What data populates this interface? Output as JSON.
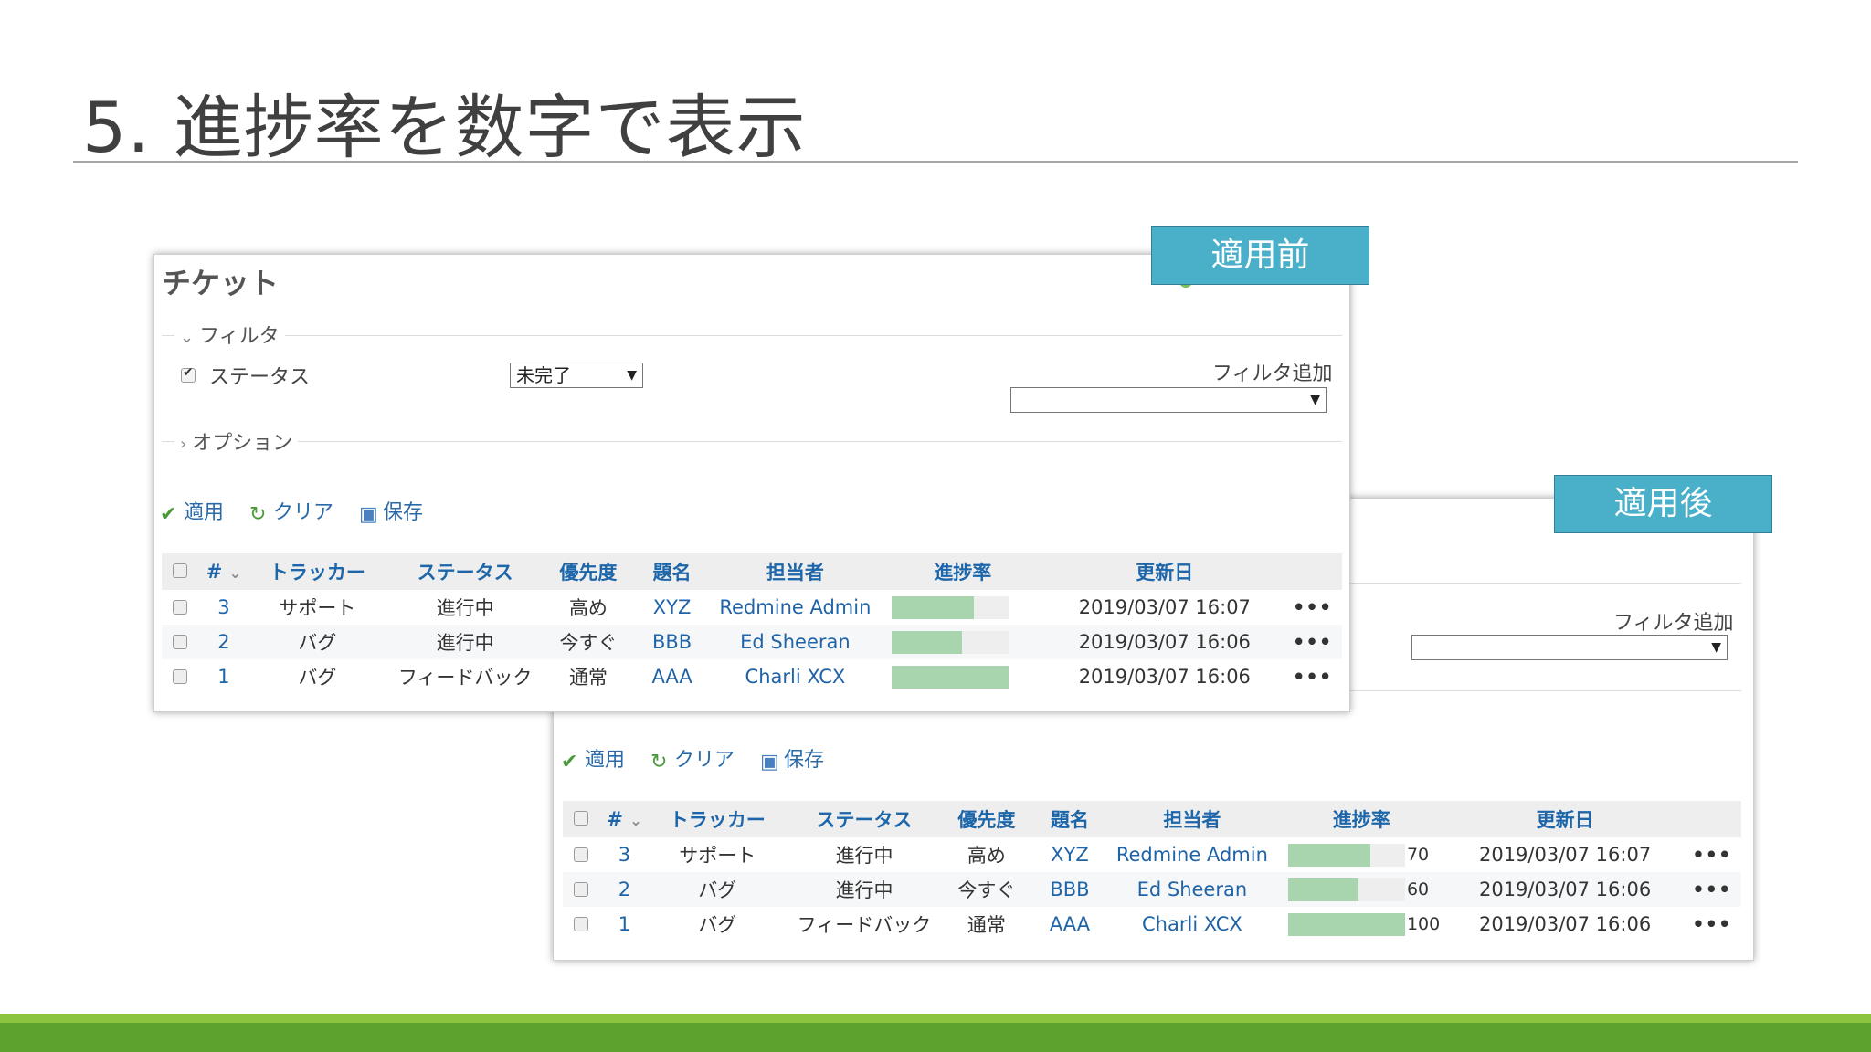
{
  "slide": {
    "title": "5. 進捗率を数字で表示"
  },
  "tags": {
    "before": "適用前",
    "after": "適用後"
  },
  "panel": {
    "heading": "チケット",
    "filter_legend": "フィルタ",
    "status_label": "ステータス",
    "status_value": "未完了",
    "add_filter_label": "フィルタ追加",
    "options_legend": "オプション",
    "actions": {
      "apply": "適用",
      "clear": "クリア",
      "save": "保存"
    },
    "columns": [
      "#",
      "トラッカー",
      "ステータス",
      "優先度",
      "題名",
      "担当者",
      "進捗率",
      "更新日"
    ],
    "rows": [
      {
        "id": "3",
        "tracker": "サポート",
        "status": "進行中",
        "priority": "高め",
        "subject": "XYZ",
        "assignee": "Redmine Admin",
        "progress": 70,
        "progress_text": "70",
        "updated": "2019/03/07 16:07"
      },
      {
        "id": "2",
        "tracker": "バグ",
        "status": "進行中",
        "priority": "今すぐ",
        "subject": "BBB",
        "assignee": "Ed Sheeran",
        "progress": 60,
        "progress_text": "60",
        "updated": "2019/03/07 16:06"
      },
      {
        "id": "1",
        "tracker": "バグ",
        "status": "フィードバック",
        "priority": "通常",
        "subject": "AAA",
        "assignee": "Charli XCX",
        "progress": 100,
        "progress_text": "100",
        "updated": "2019/03/07 16:06"
      }
    ],
    "more": "•••"
  },
  "colors": {
    "tag_bg": "#4aafc9",
    "progress_fill": "#a8d5ad",
    "link": "#2064a8",
    "footer_green": "#5da22e"
  }
}
